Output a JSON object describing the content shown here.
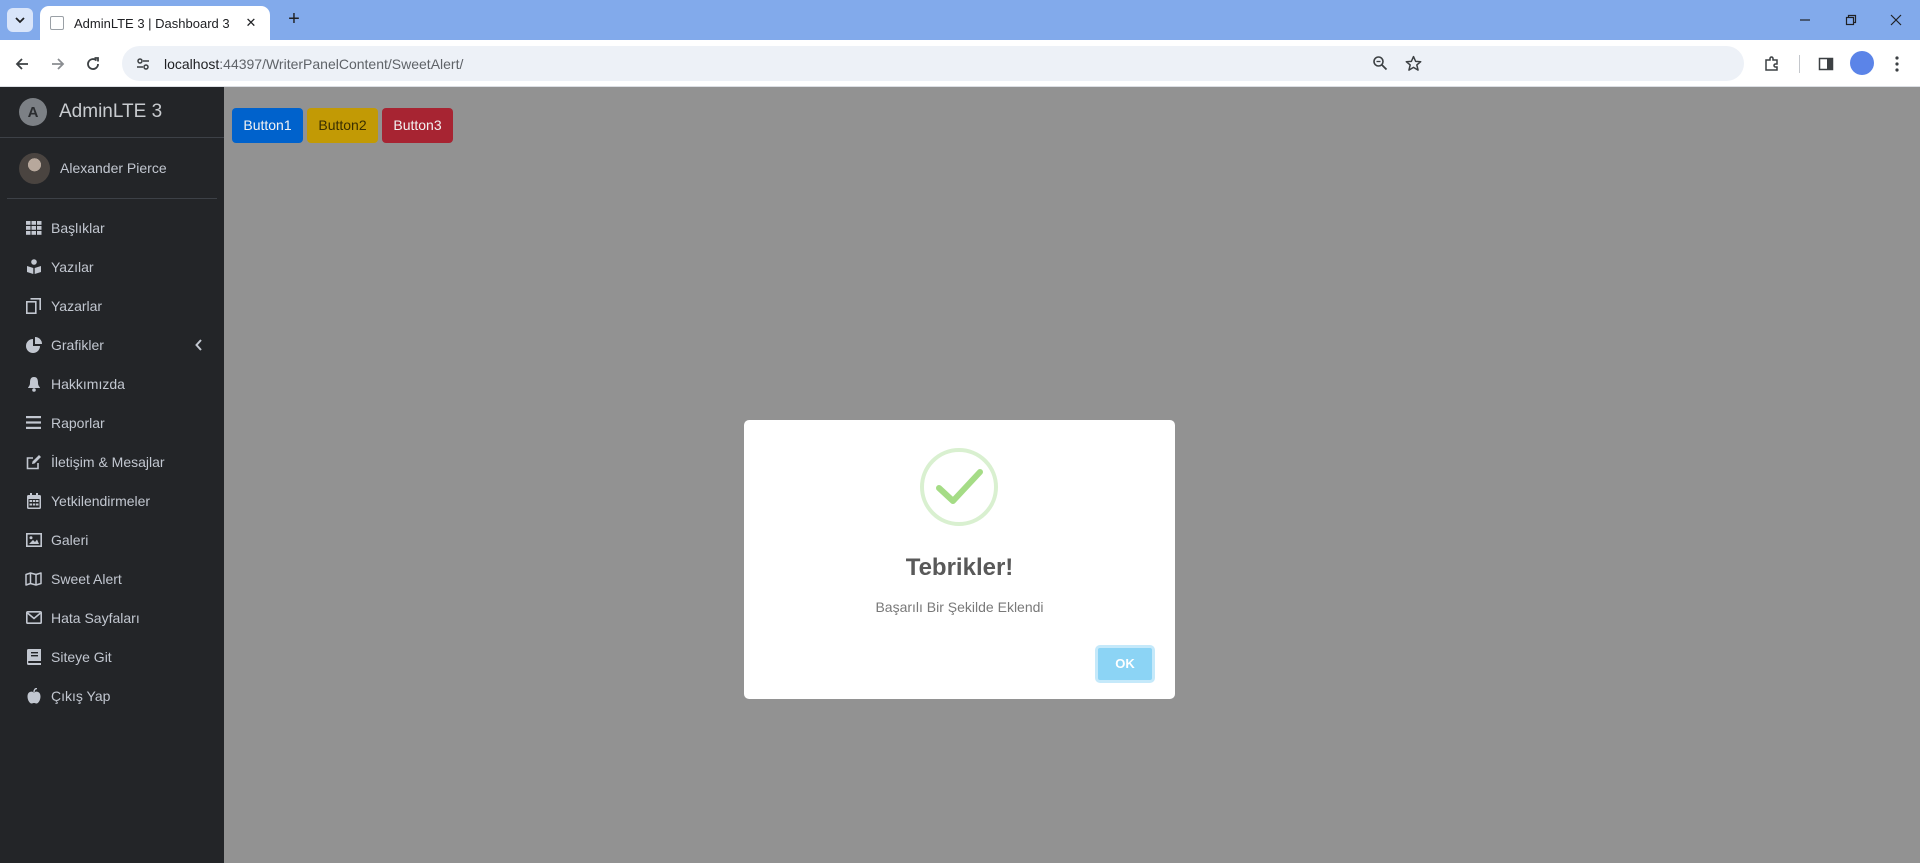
{
  "browser": {
    "tab_title": "AdminLTE 3 | Dashboard 3",
    "url_host": "localhost",
    "url_rest": ":44397/WriterPanelContent/SweetAlert/"
  },
  "sidebar": {
    "brand": "AdminLTE 3",
    "brand_logo": "A",
    "user_name": "Alexander Pierce",
    "items": [
      {
        "label": "Başlıklar",
        "icon": "grid-icon"
      },
      {
        "label": "Yazılar",
        "icon": "book-reader-icon"
      },
      {
        "label": "Yazarlar",
        "icon": "copy-icon"
      },
      {
        "label": "Grafikler",
        "icon": "pie-chart-icon"
      },
      {
        "label": "Hakkımızda",
        "icon": "bell-icon"
      },
      {
        "label": "Raporlar",
        "icon": "bars-icon"
      },
      {
        "label": "İletişim & Mesajlar",
        "icon": "edit-icon"
      },
      {
        "label": "Yetkilendirmeler",
        "icon": "calendar-icon"
      },
      {
        "label": "Galeri",
        "icon": "image-icon"
      },
      {
        "label": "Sweet Alert",
        "icon": "map-icon"
      },
      {
        "label": "Hata Sayfaları",
        "icon": "envelope-icon"
      },
      {
        "label": "Siteye Git",
        "icon": "book-icon"
      },
      {
        "label": "Çıkış Yap",
        "icon": "apple-icon"
      }
    ]
  },
  "buttons": [
    {
      "label": "Button1",
      "color": "#0062cc"
    },
    {
      "label": "Button2",
      "color": "#c29a05"
    },
    {
      "label": "Button3",
      "color": "#a72432"
    }
  ],
  "modal": {
    "title": "Tebrikler!",
    "text": "Başarılı Bir Şekilde Eklendi",
    "ok_label": "OK",
    "icon": "success-check-icon"
  }
}
